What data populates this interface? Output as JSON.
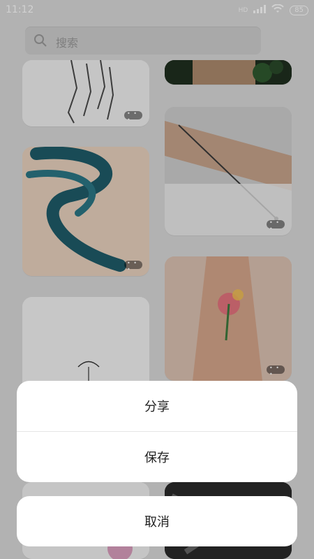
{
  "status": {
    "time": "11:12",
    "network": "HD",
    "battery": "85"
  },
  "search": {
    "placeholder": "搜索"
  },
  "action_sheet": {
    "share": "分享",
    "save": "保存",
    "cancel": "取消"
  }
}
